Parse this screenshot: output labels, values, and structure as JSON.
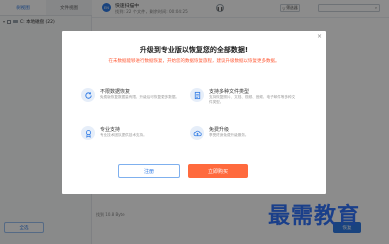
{
  "window": {
    "tabs": [
      "树视图",
      "文件视图"
    ],
    "tree_item": "C: 本地磁盘 (22)",
    "select_all": "全选",
    "bottom_status": "找到 10.8 Byte",
    "recover_button": "恢复"
  },
  "scan": {
    "logo": "EN",
    "title": "快速扫描中",
    "subtitle": "找到: 22 个文件，剩余时间: 00:04:25",
    "pause_icon": "pause-icon"
  },
  "toolbar": {
    "filter_label": "筛选器",
    "search_placeholder": "",
    "search_glyph": "⌕"
  },
  "dialog": {
    "close": "×",
    "title": "升级到专业版以恢复您的全部数据!",
    "subtitle": "在未数据能够进行数据恢复，开始您的数据恢复旅程，建议升级数据以恢复更多数据。",
    "features": [
      {
        "icon": "recovery-icon",
        "title": "不限数据恢复",
        "desc": "免费版恢复数据量有限，升级后可恢复更多数据。"
      },
      {
        "icon": "file-type-icon",
        "title": "支持多种文件类型",
        "desc": "支持恢复照片、文档、视频、音频、电子邮件等多种文件类型。"
      },
      {
        "icon": "support-icon",
        "title": "专业支持",
        "desc": "专业技术团队提供技术支持。"
      },
      {
        "icon": "upgrade-icon",
        "title": "免费升级",
        "desc": "享受终身免费升级服务。"
      }
    ],
    "register_button": "注册",
    "buy_button": "立即购买"
  },
  "watermark": "最需教育",
  "colors": {
    "accent": "#2f7be5",
    "buy": "#ff6a3d",
    "subtitle": "#ff5a36"
  }
}
